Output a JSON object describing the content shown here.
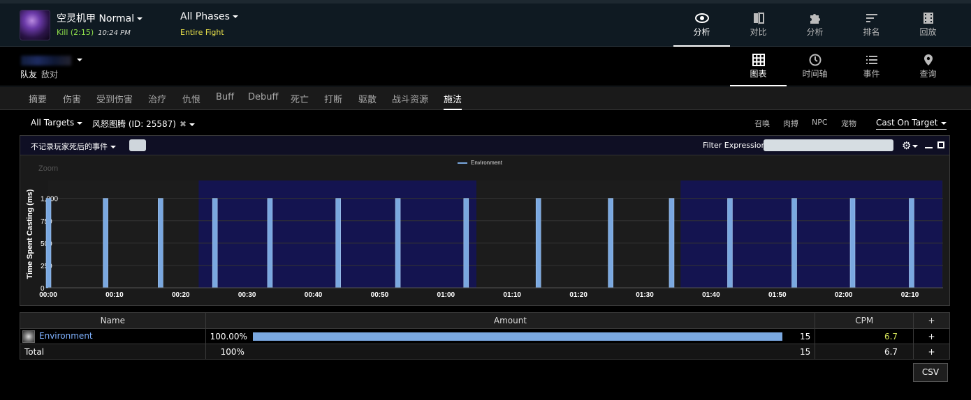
{
  "header": {
    "boss_name": "空灵机甲 Normal",
    "kill_text": "Kill (2:15)",
    "kill_time": "10:24 PM",
    "phase_name": "All Phases",
    "phase_sub": "Entire Fight",
    "nav_tabs": [
      {
        "label": "分析",
        "icon": "eye-icon"
      },
      {
        "label": "对比",
        "icon": "compare-icon"
      },
      {
        "label": "分析",
        "icon": "puzzle-icon"
      },
      {
        "label": "排名",
        "icon": "ranking-icon"
      },
      {
        "label": "回放",
        "icon": "replay-icon"
      }
    ]
  },
  "secondary": {
    "team_friendly": "队友",
    "team_enemy": "敌对",
    "view_tabs": [
      {
        "label": "图表",
        "icon": "grid-icon"
      },
      {
        "label": "时间轴",
        "icon": "clock-icon"
      },
      {
        "label": "事件",
        "icon": "list-icon"
      },
      {
        "label": "查询",
        "icon": "location-pin-icon"
      }
    ]
  },
  "subtabs": [
    "摘要",
    "伤害",
    "受到伤害",
    "治疗",
    "仇恨",
    "Buff",
    "Debuff",
    "死亡",
    "打断",
    "驱散",
    "战斗资源",
    "施法"
  ],
  "filters": {
    "targets": "All Targets",
    "ability": "风怒图腾 (ID: 25587)",
    "options": [
      "召唤",
      "肉搏",
      "NPC",
      "宠物"
    ],
    "cast_mode": "Cast On Target"
  },
  "panel": {
    "hide_dead": "不记录玩家死后的事件",
    "filter_label": "Filter Expression:",
    "filter_value": ""
  },
  "chart_data": {
    "type": "bar",
    "legend": [
      "Environment"
    ],
    "zoom_label": "Zoom",
    "ylabel": "Time Spent Casting (ms)",
    "ylim": [
      0,
      1200
    ],
    "yticks": [
      "0",
      "250",
      "500",
      "750",
      "1,000"
    ],
    "xlim": [
      0,
      135
    ],
    "xticks": [
      "00:00",
      "00:10",
      "00:20",
      "00:30",
      "00:40",
      "00:50",
      "01:00",
      "01:10",
      "01:20",
      "01:30",
      "01:40",
      "01:50",
      "02:00",
      "02:10"
    ],
    "series": [
      {
        "name": "Environment",
        "color": "#7aa8e0",
        "x": [
          0,
          8.6,
          16.9,
          25.1,
          33.4,
          43.7,
          52.7,
          63.0,
          73.9,
          84.8,
          94.0,
          102.8,
          112.5,
          121.3,
          130.2
        ],
        "values": [
          1000,
          1000,
          1000,
          1000,
          1000,
          1000,
          1000,
          1000,
          1000,
          1000,
          1000,
          1000,
          1000,
          1000,
          1000
        ]
      }
    ],
    "highlight_ranges": [
      [
        22.7,
        64.6
      ],
      [
        95.4,
        134.9
      ]
    ]
  },
  "table": {
    "headers": [
      "Name",
      "Amount",
      "CPM",
      "+"
    ],
    "rows": [
      {
        "name": "Environment",
        "pct": "100.00%",
        "fraction": 1.0,
        "count": "15",
        "cpm": "6.7",
        "plus": "+"
      }
    ],
    "total": {
      "name": "Total",
      "pct": "100%",
      "count": "15",
      "cpm": "6.7",
      "plus": "+"
    }
  },
  "csv_label": "CSV",
  "colors": {
    "bar": "#7aa8e0",
    "highlight": "#141450",
    "kill": "#8fe04a",
    "phase_sub": "#e8e04a"
  }
}
